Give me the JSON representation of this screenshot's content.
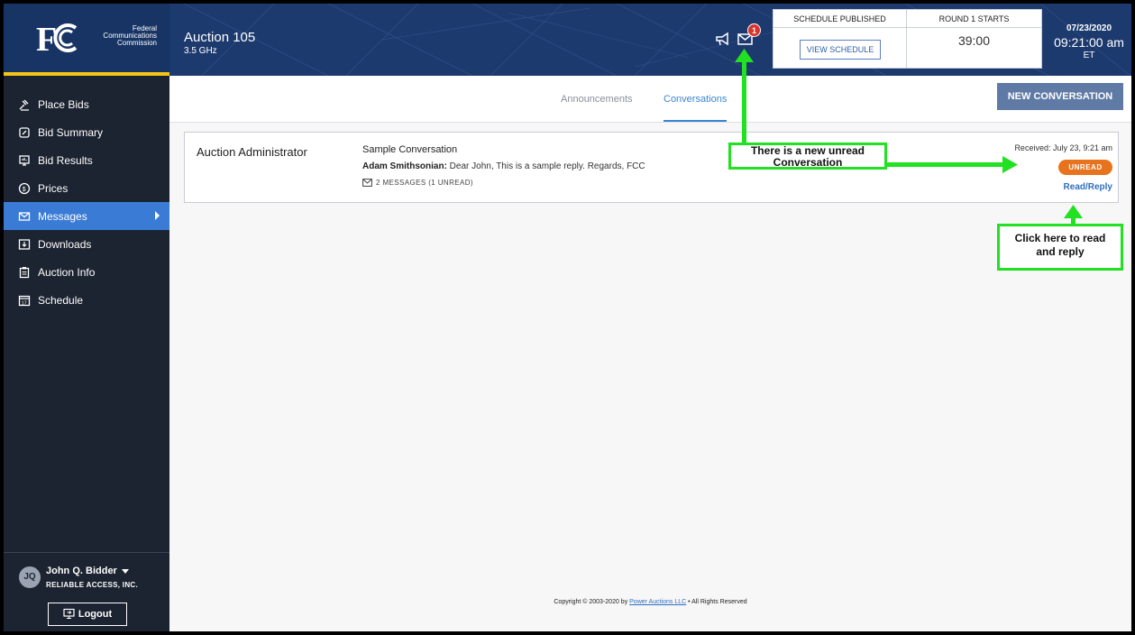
{
  "header": {
    "org_name_line1": "Federal",
    "org_name_line2": "Communications",
    "org_name_line3": "Commission",
    "auction_title": "Auction 105",
    "auction_subtitle": "3.5 GHz",
    "message_badge_count": "1",
    "schedule": {
      "status_label": "SCHEDULE PUBLISHED",
      "view_button": "VIEW SCHEDULE",
      "round_label": "ROUND 1 STARTS",
      "round_timer": "39:00"
    },
    "date": "07/23/2020",
    "time": "09:21:00 am",
    "timezone": "ET"
  },
  "sidebar": {
    "items": [
      {
        "label": "Place Bids",
        "icon": "gavel-icon"
      },
      {
        "label": "Bid Summary",
        "icon": "bid-summary-icon"
      },
      {
        "label": "Bid Results",
        "icon": "bid-results-icon"
      },
      {
        "label": "Prices",
        "icon": "prices-icon"
      },
      {
        "label": "Messages",
        "icon": "envelope-icon"
      },
      {
        "label": "Downloads",
        "icon": "download-icon"
      },
      {
        "label": "Auction Info",
        "icon": "clipboard-icon"
      },
      {
        "label": "Schedule",
        "icon": "calendar-icon"
      }
    ],
    "active_item": "Messages",
    "user": {
      "initials": "JQ",
      "name": "John Q. Bidder",
      "organization": "RELIABLE ACCESS, INC.",
      "logout_label": "Logout"
    }
  },
  "main": {
    "tabs": [
      {
        "label": "Announcements"
      },
      {
        "label": "Conversations"
      }
    ],
    "active_tab": "Conversations",
    "new_conversation_label": "NEW CONVERSATION",
    "conversation": {
      "from": "Auction Administrator",
      "subject": "Sample Conversation",
      "preview_author": "Adam Smithsonian:",
      "preview_text": " Dear John, This is a sample reply. Regards, FCC",
      "message_count": "2 MESSAGES (1 UNREAD)",
      "received": "Received: July 23, 9:21 am",
      "status_badge": "UNREAD",
      "read_reply_label": "Read/Reply"
    }
  },
  "footer": {
    "copyright_prefix": "Copyright © 2003-2020 by ",
    "company_link": "Power Auctions LLC",
    "copyright_suffix": " • All Rights Reserved"
  },
  "annotations": {
    "unread_callout_line1": "There is a new unread",
    "unread_callout_line2": "Conversation",
    "read_callout_line1": "Click here to read",
    "read_callout_line2": "and reply"
  },
  "colors": {
    "header_bg": "#1d3a6e",
    "sidebar_bg": "#1c2331",
    "active_nav": "#3a7bd5",
    "accent_link": "#3a86d4",
    "unread_badge": "#e8731e",
    "annotation_green": "#22e022",
    "brand_yellow": "#f5c518"
  }
}
